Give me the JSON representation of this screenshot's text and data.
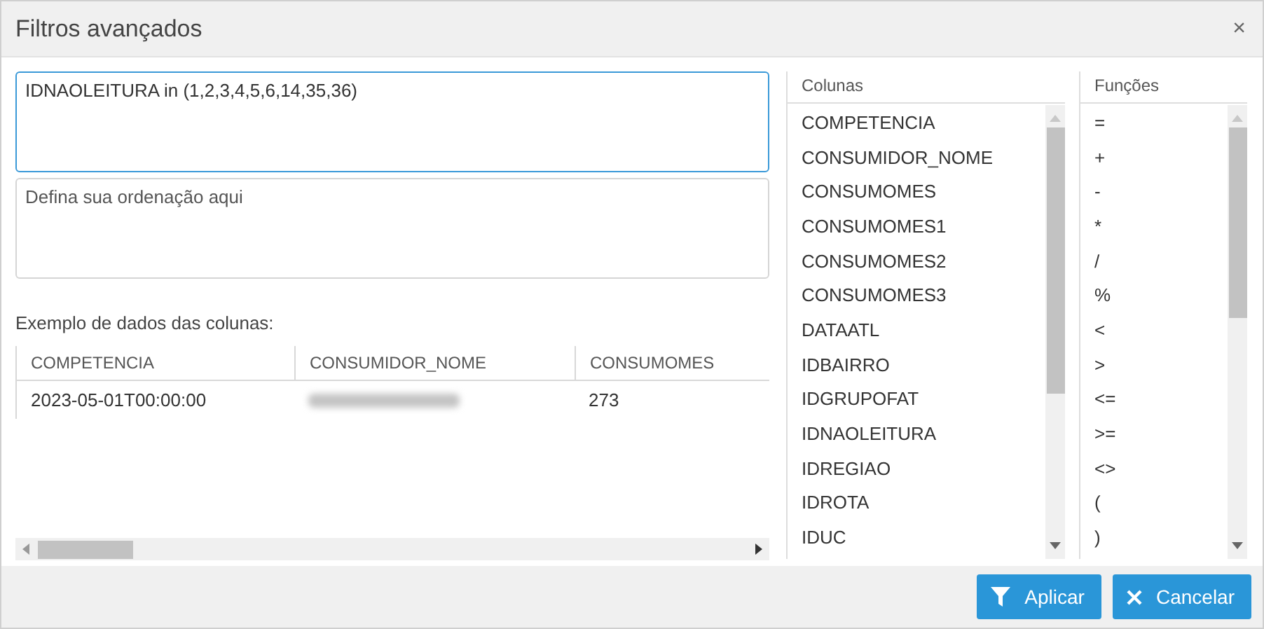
{
  "window": {
    "title": "Filtros avançados",
    "close": "×"
  },
  "filter": {
    "value": "IDNAOLEITURA in (1,2,3,4,5,6,14,35,36)",
    "focused": true
  },
  "ordering": {
    "placeholder": "Defina sua ordenação aqui"
  },
  "sample": {
    "label": "Exemplo de dados das colunas:",
    "columns": [
      "COMPETENCIA",
      "CONSUMIDOR_NOME",
      "CONSUMOMES"
    ],
    "rows": [
      [
        {
          "text": "2023-05-01T00:00:00"
        },
        {
          "kind": "blurred"
        },
        {
          "text": "273"
        }
      ]
    ]
  },
  "columns_list": {
    "title": "Colunas",
    "items": [
      "COMPETENCIA",
      "CONSUMIDOR_NOME",
      "CONSUMOMES",
      "CONSUMOMES1",
      "CONSUMOMES2",
      "CONSUMOMES3",
      "DATAATL",
      "IDBAIRRO",
      "IDGRUPOFAT",
      "IDNAOLEITURA",
      "IDREGIAO",
      "IDROTA",
      "IDUC"
    ]
  },
  "functions_list": {
    "title": "Funções",
    "items": [
      "=",
      "+",
      "-",
      "*",
      "/",
      "%",
      "<",
      ">",
      "<=",
      ">=",
      "<>",
      "(",
      ")"
    ]
  },
  "buttons": [
    {
      "label": "Aplicar",
      "kind": "apply"
    },
    {
      "label": "Cancelar",
      "kind": "cancel"
    }
  ]
}
